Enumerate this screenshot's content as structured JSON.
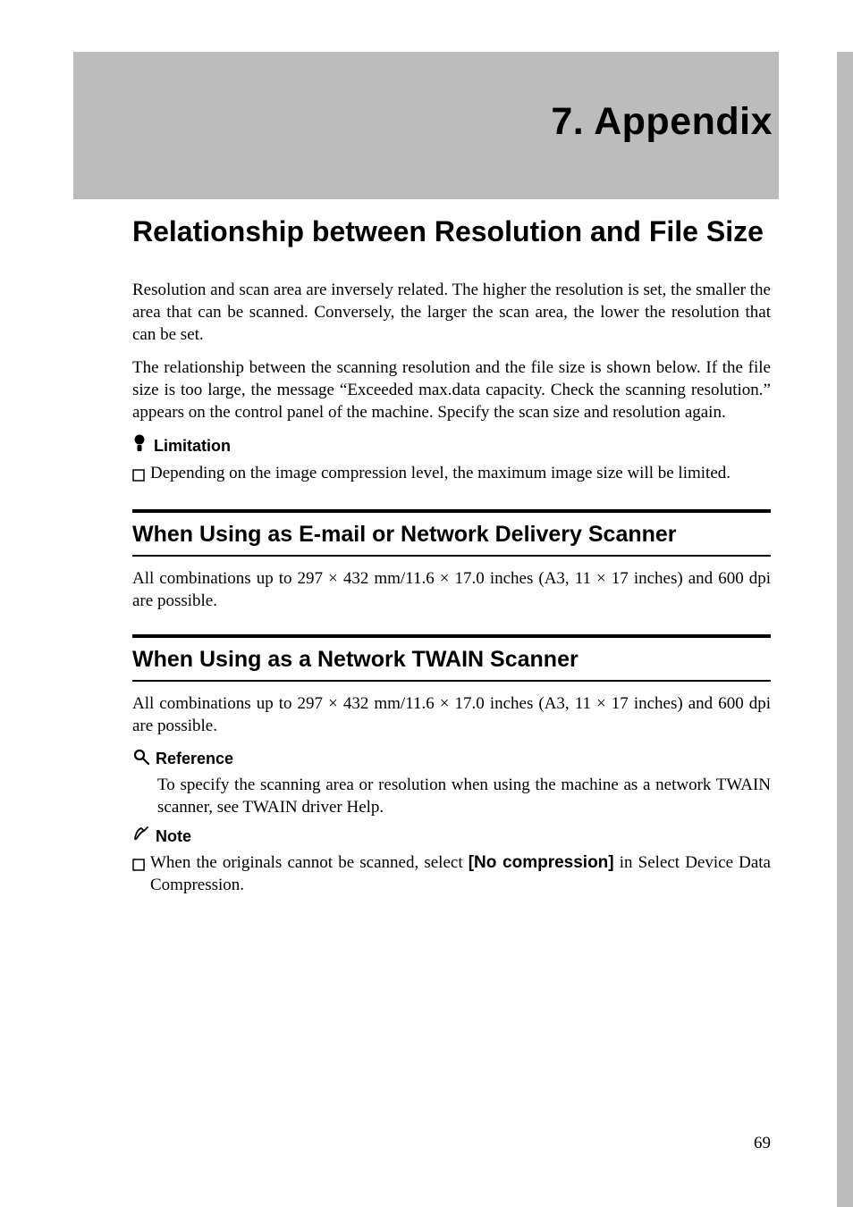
{
  "chapter": {
    "title": "7. Appendix"
  },
  "section": {
    "title": "Relationship between Resolution and File Size"
  },
  "para1": "Resolution and scan area are inversely related. The higher the resolution is set, the smaller the area that can be scanned. Conversely, the larger the scan area, the lower the resolution that can be set.",
  "para2": "The relationship between the scanning resolution and the file size is shown below. If the file size is too large, the message “Exceeded max.data capacity. Check the scanning resolution.” appears on the control panel of the machine. Specify the scan size and resolution again.",
  "limitation": {
    "label": "Limitation",
    "bullet": "Depending on the image compression level, the maximum image size will be limited."
  },
  "sub1": {
    "title": "When Using as E-mail or Network Delivery Scanner",
    "body": "All combinations up to 297 × 432 mm/11.6 × 17.0 inches (A3, 11 × 17 inches) and 600 dpi are possible."
  },
  "sub2": {
    "title": "When Using as a Network TWAIN Scanner",
    "body": "All combinations up to 297 × 432 mm/11.6 × 17.0 inches (A3, 11 × 17 inches) and 600 dpi are possible."
  },
  "reference": {
    "label": "Reference",
    "body": "To specify the scanning area or resolution when using the machine as a network TWAIN scanner, see TWAIN driver Help."
  },
  "note": {
    "label": "Note",
    "prefix": "When the originals cannot be scanned, select ",
    "bold": "[No compression]",
    "suffix": " in Select Device Data Compression."
  },
  "page_number": "69"
}
